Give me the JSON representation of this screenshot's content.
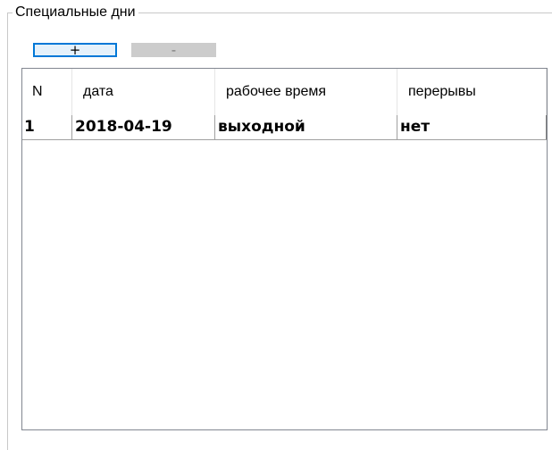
{
  "group": {
    "title": "Специальные дни"
  },
  "toolbar": {
    "add_label": "+",
    "remove_label": "-"
  },
  "table": {
    "columns": [
      "N",
      "дата",
      "рабочее время",
      "перерывы"
    ],
    "rows": [
      {
        "n": "1",
        "date": "2018-04-19",
        "work_time": "выходной",
        "breaks": "нет"
      }
    ]
  },
  "colors": {
    "add_button_border": "#0078d7",
    "add_button_bg": "#e5f1fb",
    "remove_button_bg": "#cccccc",
    "table_border": "#828790"
  }
}
